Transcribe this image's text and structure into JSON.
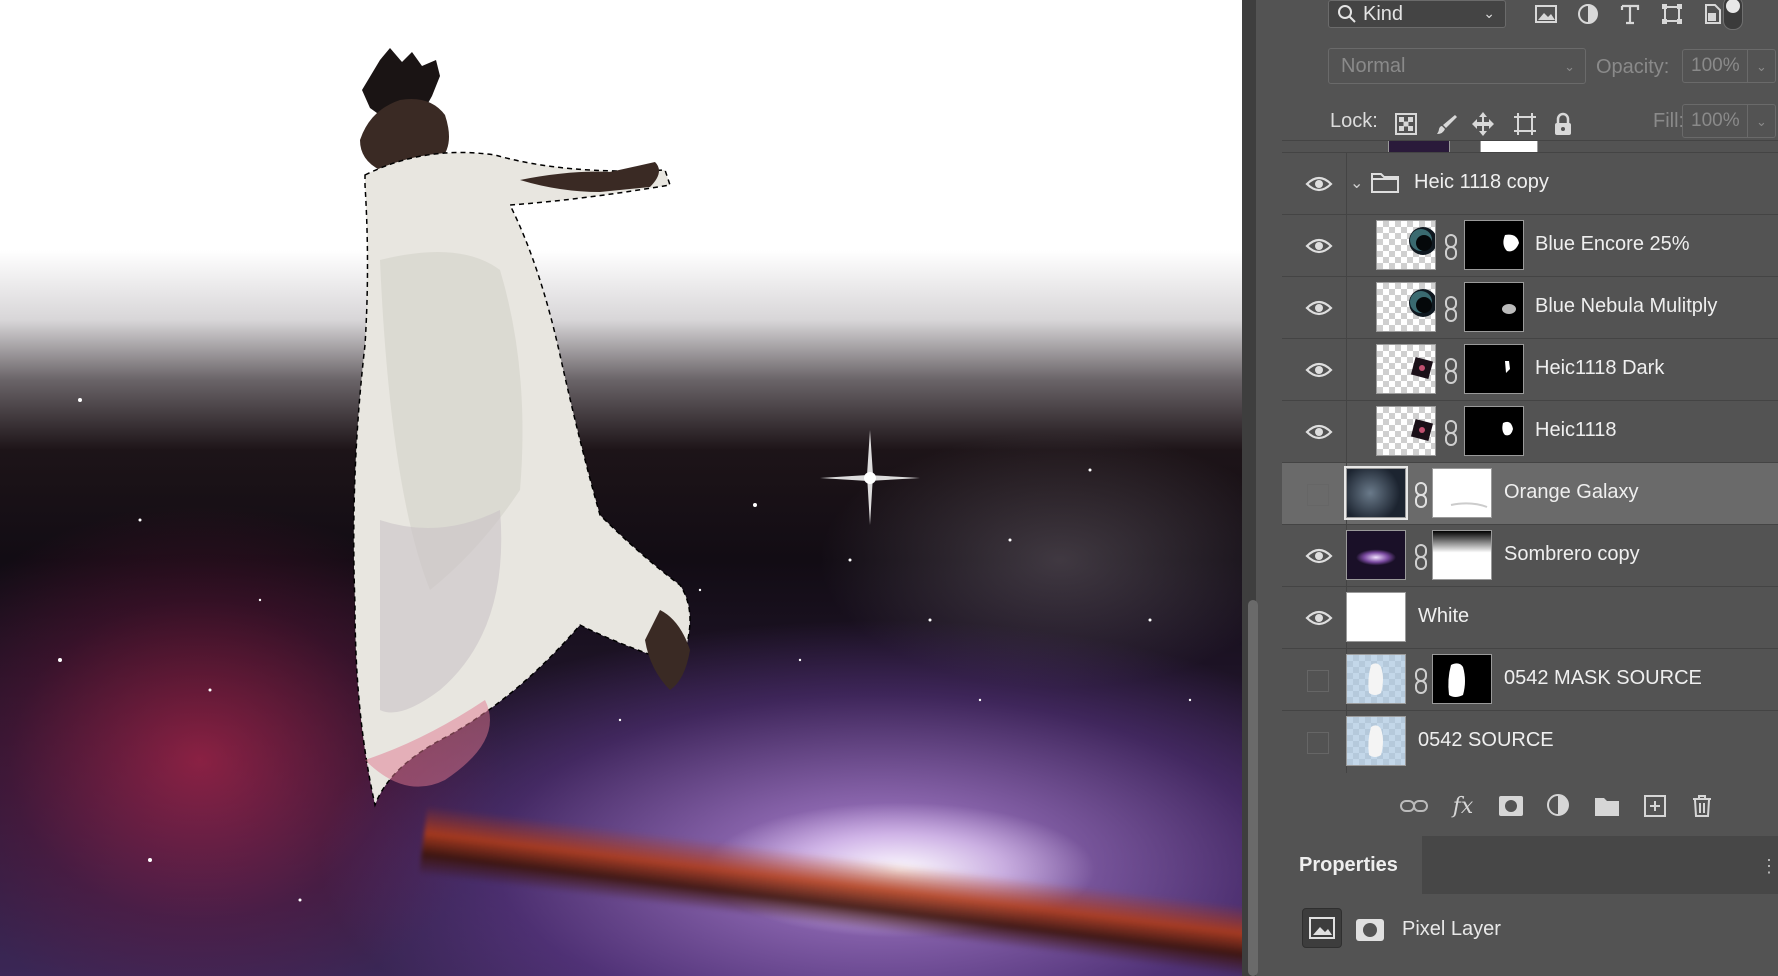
{
  "layers_panel": {
    "filter": {
      "kind_label": "Kind",
      "icons": [
        "pixel-filter-icon",
        "adjustment-filter-icon",
        "type-filter-icon",
        "shape-filter-icon",
        "smart-object-filter-icon"
      ]
    },
    "blend_mode": "Normal",
    "opacity_label": "Opacity:",
    "opacity_value": "100%",
    "lock_label": "Lock:",
    "fill_label": "Fill:",
    "fill_value": "100%",
    "layers": [
      {
        "name": "Heic 1118 copy",
        "type": "group",
        "visible": true
      },
      {
        "name": "Blue Encore 25%",
        "visible": true,
        "indent": true,
        "mask": true
      },
      {
        "name": "Blue Nebula Mulitply",
        "visible": true,
        "indent": true,
        "mask": true
      },
      {
        "name": "Heic1118 Dark",
        "visible": true,
        "indent": true,
        "mask": true
      },
      {
        "name": "Heic1118",
        "visible": true,
        "indent": true,
        "mask": true
      },
      {
        "name": "Orange Galaxy",
        "visible": false,
        "selected": true,
        "mask": true
      },
      {
        "name": "Sombrero copy",
        "visible": true,
        "mask": true
      },
      {
        "name": "White",
        "visible": true,
        "mask": false
      },
      {
        "name": "0542 MASK SOURCE",
        "visible": false,
        "mask": true
      },
      {
        "name": "0542 SOURCE",
        "visible": false,
        "mask": false
      }
    ]
  },
  "properties": {
    "tab_label": "Properties",
    "layer_type_label": "Pixel Layer"
  },
  "colors": {
    "panel_bg": "#535353",
    "selected_row": "#6a6a6a",
    "text": "#efefef"
  }
}
